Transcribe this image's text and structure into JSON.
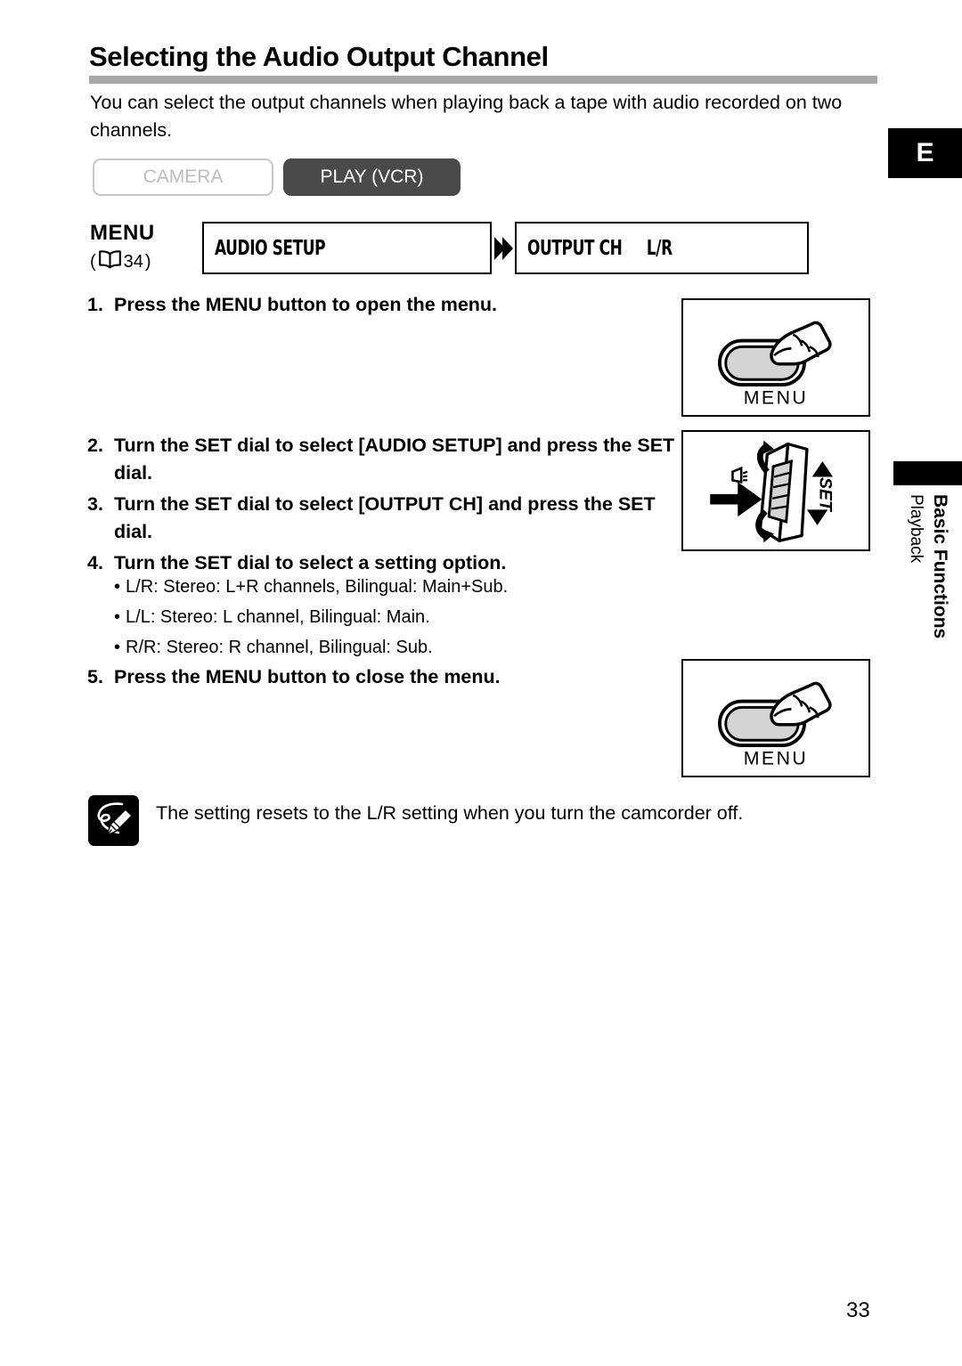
{
  "header": {
    "title": "Selecting the Audio Output Channel",
    "intro": "You can select the output channels when playing back a tape with audio recorded on two channels.",
    "edition_badge": "E"
  },
  "modes": {
    "camera_label": "CAMERA",
    "play_label": "PLAY (VCR)",
    "camera_state": "inactive",
    "play_state": "active"
  },
  "menu_path": {
    "keyword": "MENU",
    "reference_page": "34",
    "reference_open": "(",
    "reference_close": ")",
    "book_icon": "book-icon",
    "arrow_icon": "double-chevron-right-icon",
    "box1": "AUDIO SETUP",
    "box2": "OUTPUT CH     L/R"
  },
  "steps": [
    {
      "num": "1.",
      "text": "Press the MENU button to open the menu."
    },
    {
      "num": "2.",
      "text": "Turn the SET dial to select [AUDIO SETUP] and press the SET dial."
    },
    {
      "num": "3.",
      "text": "Turn the SET dial to select [OUTPUT CH] and press the SET dial."
    },
    {
      "num": "4.",
      "text": "Turn the SET dial to select a setting option."
    },
    {
      "num": "5.",
      "text": "Press the MENU button to close the menu."
    }
  ],
  "options": [
    "L/R: Stereo: L+R channels, Bilingual: Main+Sub.",
    "L/L: Stereo: L channel, Bilingual: Main.",
    "R/R: Stereo: R channel, Bilingual: Sub."
  ],
  "bullet_glyph": "•",
  "illustrations": {
    "menu_button_caption": "MENU",
    "set_dial_caption": "SET"
  },
  "side_tab": {
    "main": "Basic Functions",
    "sub": "Playback"
  },
  "note": {
    "icon": "memo-pencil-icon",
    "text": "The setting resets to the L/R setting when you turn the camcorder off."
  },
  "footer": {
    "page_number": "33"
  },
  "colors": {
    "heading_rule": "#a9a9a9",
    "active_pill": "#4a4a4a",
    "inactive_pill_border": "#c7c7c7",
    "inactive_pill_text": "#bdbdbd",
    "button_fill": "#d4d4d4"
  }
}
